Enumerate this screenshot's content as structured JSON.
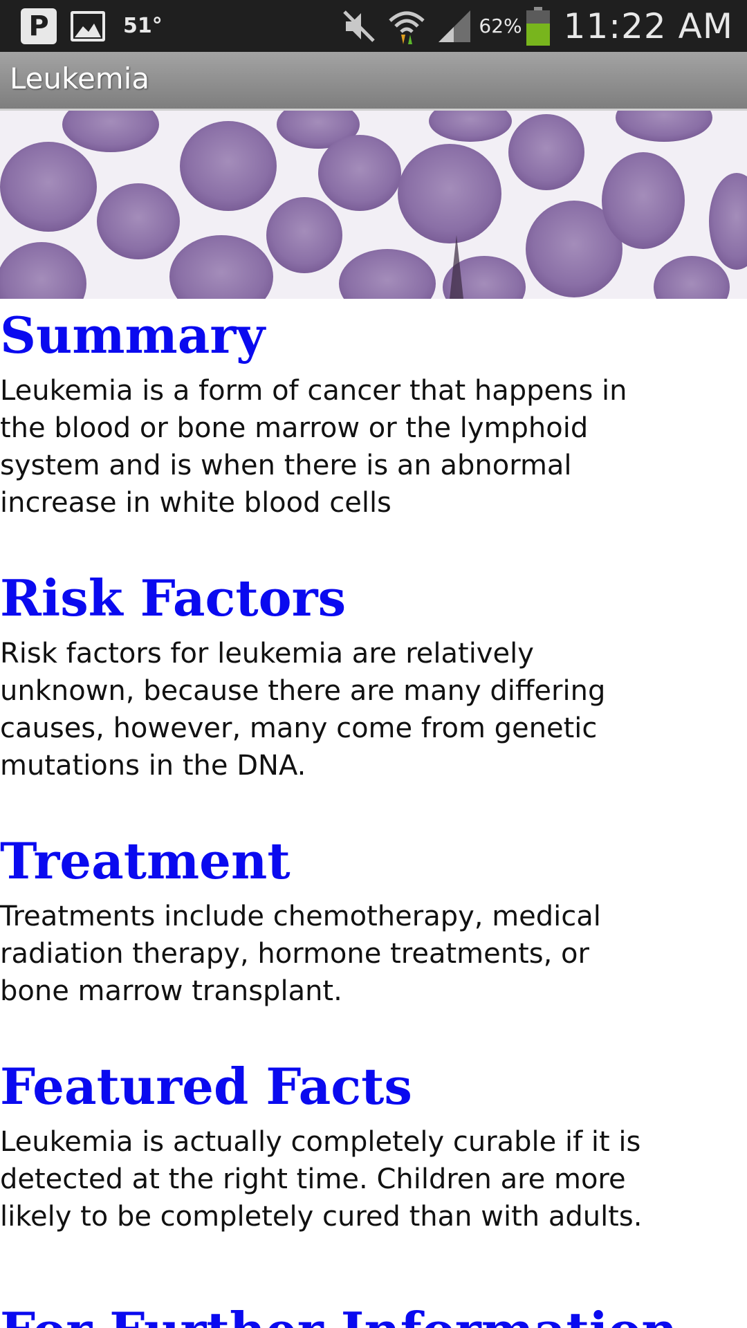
{
  "status_bar": {
    "notification_icons": [
      "parking-icon",
      "image-icon"
    ],
    "parking_glyph": "P",
    "temperature": "51°",
    "battery_percent": "62%",
    "battery_level": 0.62,
    "time": "11:22 AM",
    "status_icons": [
      "mute-icon",
      "wifi-icon",
      "signal-icon",
      "battery-icon"
    ]
  },
  "app": {
    "title": "Leukemia"
  },
  "hero": {
    "icon": "blood-cells-image"
  },
  "sections": [
    {
      "heading": "Summary",
      "body": "Leukemia is a form of cancer that happens in the blood or bone marrow or the lymphoid system and is when there is an abnormal increase in white blood cells"
    },
    {
      "heading": "Risk Factors",
      "body": "Risk factors for leukemia are relatively unknown, because there are many differing causes, however, many come from genetic mutations in the DNA."
    },
    {
      "heading": "Treatment",
      "body": "Treatments include chemotherapy, medical radiation therapy, hormone treatments, or bone marrow transplant."
    },
    {
      "heading": "Featured Facts",
      "body": "Leukemia is actually completely curable if it is detected at the right time.  Children are more likely to be completely cured than with adults."
    },
    {
      "heading": "For Further Information"
    }
  ],
  "colors": {
    "heading": "#0a0aef",
    "status_bar_bg": "#1f1f1f",
    "battery_fill": "#78b51d",
    "cell_purple": "#8a6fa6"
  }
}
